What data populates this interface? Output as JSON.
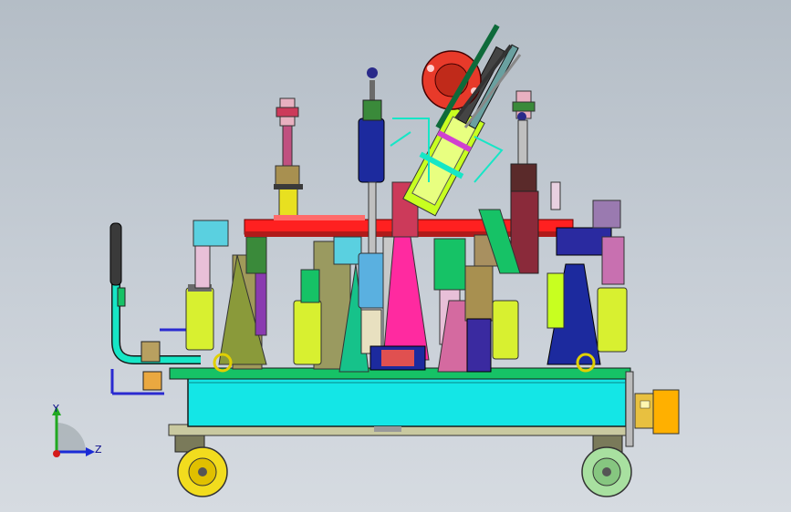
{
  "viewport": {
    "background_top": "#b4bdc6",
    "background_bottom": "#d6dbe1"
  },
  "triad": {
    "y_label": "Y",
    "z_label": "Z",
    "y_color": "#21a821",
    "z_color": "#1a2bd6",
    "x_color": "#d41a1a"
  },
  "colors": {
    "base_frame": "#14e6e6",
    "rail_red": "#ff2020",
    "lime": "#c8ff20",
    "dark_blue": "#1c2a9e",
    "magenta": "#ff2aa0",
    "green_plate": "#16c266",
    "olive": "#8a9a3a",
    "orange_box": "#ffb000",
    "red_motor": "#e83a2a",
    "purple": "#8a3ab0",
    "wheel_yellow": "#f2dc1e",
    "wheel_green": "#a8e0a0"
  }
}
